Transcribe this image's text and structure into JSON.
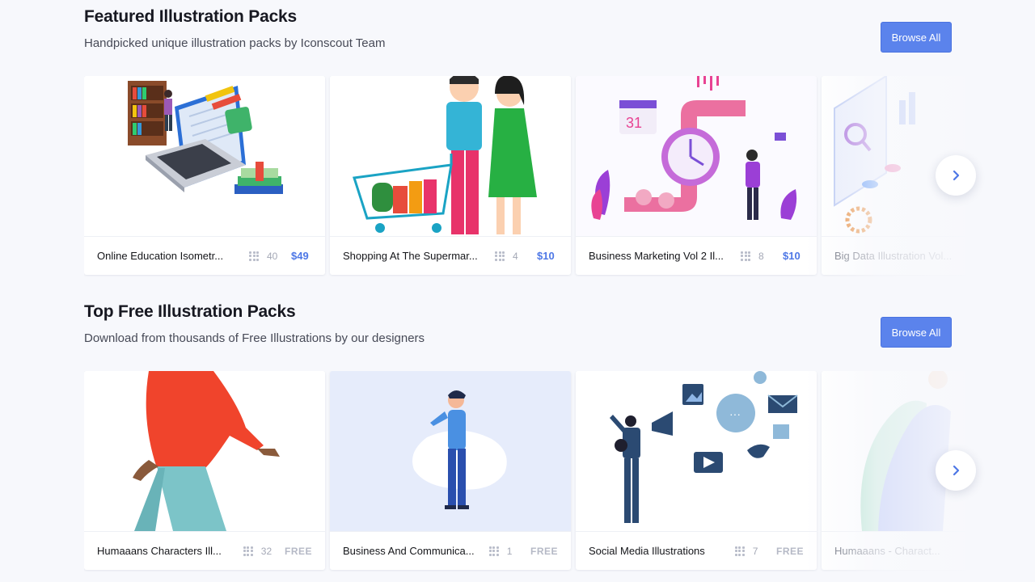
{
  "featured": {
    "title": "Featured Illustration Packs",
    "subtitle": "Handpicked unique illustration packs by Iconscout Team",
    "browse_label": "Browse All",
    "cards": [
      {
        "name": "Online Education Isometr...",
        "count": "40",
        "price": "$49"
      },
      {
        "name": "Shopping At The Supermar...",
        "count": "4",
        "price": "$10"
      },
      {
        "name": "Business Marketing Vol 2 Il...",
        "count": "8",
        "price": "$10"
      },
      {
        "name": "Big Data Illustration Vol...",
        "count": "",
        "price": ""
      }
    ]
  },
  "free": {
    "title": "Top Free Illustration Packs",
    "subtitle": "Download from thousands of Free Illustrations by our designers",
    "browse_label": "Browse All",
    "cards": [
      {
        "name": "Humaaans Characters Ill...",
        "count": "32",
        "price": "FREE"
      },
      {
        "name": "Business And Communica...",
        "count": "1",
        "price": "FREE"
      },
      {
        "name": "Social Media Illustrations",
        "count": "7",
        "price": "FREE"
      },
      {
        "name": "Humaaans - Charact...",
        "count": "",
        "price": ""
      }
    ]
  },
  "icons": {
    "next": "chevron-right-icon",
    "pack_count": "grid-icon"
  },
  "colors": {
    "accent": "#5b83ec",
    "price": "#4d77e6",
    "free": "#b5b9c6",
    "background": "#f7f8fc"
  }
}
